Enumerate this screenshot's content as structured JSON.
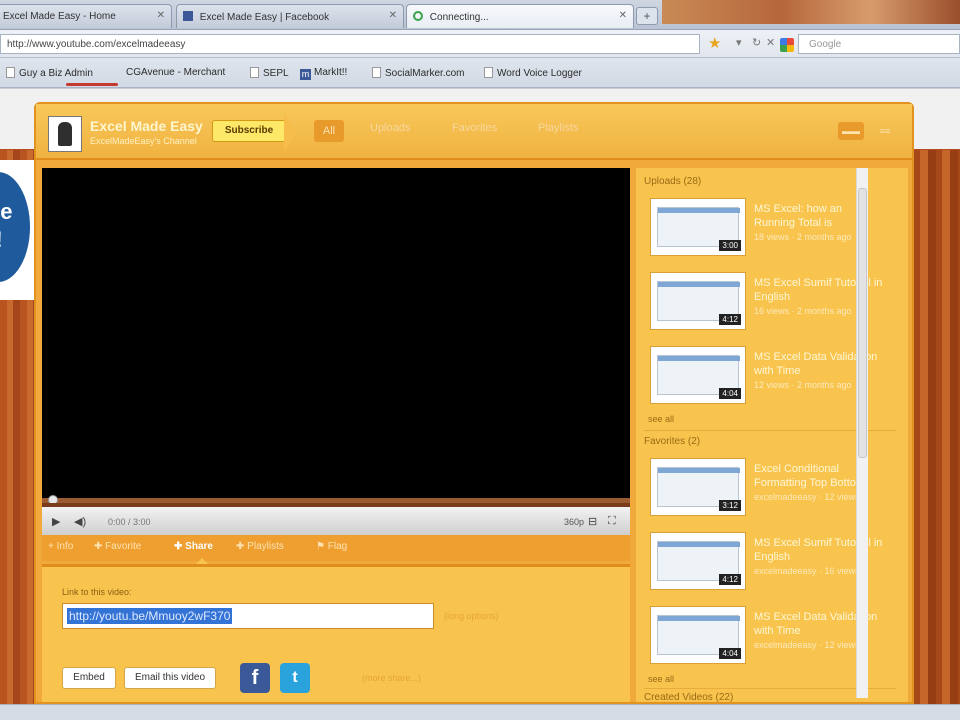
{
  "browser": {
    "tabs": [
      {
        "label": "Excel Made Easy - Home"
      },
      {
        "label": "Excel Made Easy | Facebook"
      },
      {
        "label": "Connecting..."
      }
    ],
    "new_tab": "+",
    "url": "http://www.youtube.com/excelmadeeasy",
    "search_placeholder": "Google",
    "bookmarks": [
      "Guy a Biz Admin",
      "CGAvenue - Merchant",
      "SEPL",
      "MarkIt!!",
      "SocialMarker.com",
      "Word Voice Logger"
    ]
  },
  "background": {
    "badge_text": "se\n!!"
  },
  "channel": {
    "name": "Excel Made Easy",
    "subtitle": "ExcelMadeEasy's Channel",
    "subscribe": "Subscribe",
    "tabs": [
      "All",
      "Uploads",
      "Favorites",
      "Playlists"
    ],
    "top_icons": [
      "▬▬",
      "≡≡"
    ]
  },
  "player": {
    "time": "0:00 / 3:00",
    "quality": "360p",
    "actions": [
      "Info",
      "Favorite",
      "Share",
      "Playlists",
      "Flag"
    ]
  },
  "share": {
    "label": "Link to this video:",
    "link": "http://youtu.be/Mmuoy2wF370",
    "options": "(long options)",
    "embed": "Embed",
    "email": "Email this video",
    "more": "(more share...)"
  },
  "sidebar": {
    "uploads_title": "Uploads (28)",
    "favorites_title": "Favorites (2)",
    "playlists_title": "Created Videos (22)",
    "see_all": "see all",
    "uploads": [
      {
        "title": "MS Excel: how an Running Total is",
        "meta": "18 views  ·  2 months ago",
        "duration": "3:00"
      },
      {
        "title": "MS Excel Sumif Tutorial in English",
        "meta": "16 views  ·  2 months ago",
        "duration": "4:12"
      },
      {
        "title": "MS Excel Data Validation with Time",
        "meta": "12 views  ·  2 months ago",
        "duration": "4:04"
      }
    ],
    "favorites": [
      {
        "title": "Excel Conditional Formatting Top Bottom",
        "meta": "excelmadeeasy  ·  12 views",
        "duration": "3:12"
      },
      {
        "title": "MS Excel Sumif Tutorial in English",
        "meta": "excelmadeeasy  ·  16 views",
        "duration": "4:12"
      },
      {
        "title": "MS Excel Data Validation with Time",
        "meta": "excelmadeeasy  ·  12 views",
        "duration": "4:04"
      }
    ]
  },
  "colors": {
    "frame": "#f0a93a",
    "panel": "#f8c44e",
    "header": "#f3b848",
    "link_highlight": "#3473d6",
    "facebook": "#3b5998",
    "twitter": "#2aa3dd"
  }
}
